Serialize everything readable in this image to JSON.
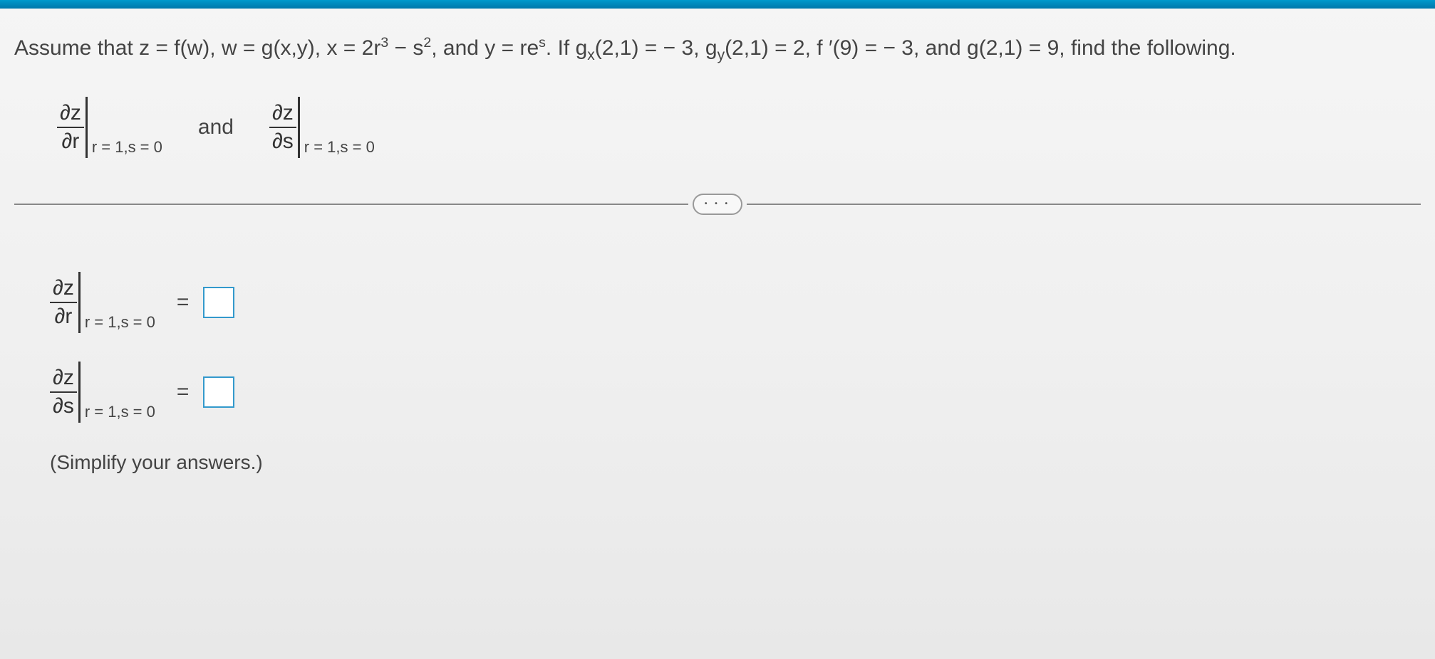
{
  "problem": {
    "prefix": "Assume that z = f(w), w = g(x,y), x = 2r",
    "sup1": "3",
    "mid1": " − s",
    "sup2": "2",
    "mid2": ", and y = re",
    "sup3": "s",
    "mid3": ". If g",
    "sub1": "x",
    "mid4": "(2,1) = − 3, g",
    "sub2": "y",
    "mid5": "(2,1) = 2, f ′(9) = − 3, and g(2,1) = 9, find the following.",
    "dz": "∂z",
    "dr": "∂r",
    "ds": "∂s",
    "eval_label": "r = 1,s = 0",
    "and": "and",
    "equals": "=",
    "simplify": "(Simplify your answers.)",
    "ellipsis": "• • •"
  },
  "chart_data": {
    "type": "table",
    "title": "Chain rule partial derivatives problem",
    "given": {
      "z": "f(w)",
      "w": "g(x,y)",
      "x": "2r^3 - s^2",
      "y": "r*e^s",
      "g_x(2,1)": -3,
      "g_y(2,1)": 2,
      "f_prime(9)": -3,
      "g(2,1)": 9
    },
    "evaluate_at": {
      "r": 1,
      "s": 0
    },
    "find": [
      "∂z/∂r",
      "∂z/∂s"
    ],
    "answers": {
      "dz_dr": null,
      "dz_ds": null
    }
  }
}
